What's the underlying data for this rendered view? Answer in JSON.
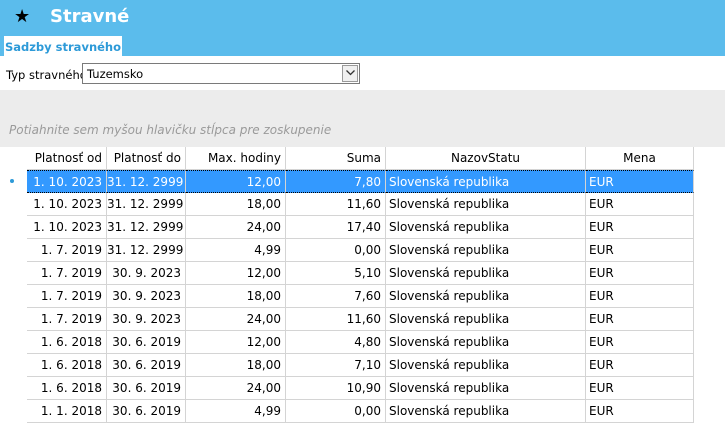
{
  "app": {
    "title": "Stravné",
    "star_icon": "star-icon"
  },
  "tabs": [
    {
      "label": "Sadzby stravného",
      "active": true
    }
  ],
  "filter": {
    "label": "Typ stravného",
    "value": "Tuzemsko"
  },
  "group_panel": {
    "hint": "Potiahnite sem myšou hlavičku stĺpca pre zoskupenie"
  },
  "grid": {
    "columns": [
      "Platnosť od",
      "Platnosť do",
      "Max. hodiny",
      "Suma",
      "NazovStatu",
      "Mena"
    ],
    "selected_row": 0,
    "rows": [
      [
        "1. 10. 2023",
        "31. 12. 2999",
        "12,00",
        "7,80",
        "Slovenská republika",
        "EUR"
      ],
      [
        "1. 10. 2023",
        "31. 12. 2999",
        "18,00",
        "11,60",
        "Slovenská republika",
        "EUR"
      ],
      [
        "1. 10. 2023",
        "31. 12. 2999",
        "24,00",
        "17,40",
        "Slovenská republika",
        "EUR"
      ],
      [
        "1. 7. 2019",
        "31. 12. 2999",
        "4,99",
        "0,00",
        "Slovenská republika",
        "EUR"
      ],
      [
        "1. 7. 2019",
        "30. 9. 2023",
        "12,00",
        "5,10",
        "Slovenská republika",
        "EUR"
      ],
      [
        "1. 7. 2019",
        "30. 9. 2023",
        "18,00",
        "7,60",
        "Slovenská republika",
        "EUR"
      ],
      [
        "1. 7. 2019",
        "30. 9. 2023",
        "24,00",
        "11,60",
        "Slovenská republika",
        "EUR"
      ],
      [
        "1. 6. 2018",
        "30. 6. 2019",
        "12,00",
        "4,80",
        "Slovenská republika",
        "EUR"
      ],
      [
        "1. 6. 2018",
        "30. 6. 2019",
        "18,00",
        "7,10",
        "Slovenská republika",
        "EUR"
      ],
      [
        "1. 6. 2018",
        "30. 6. 2019",
        "24,00",
        "10,90",
        "Slovenská republika",
        "EUR"
      ],
      [
        "1. 1. 2018",
        "30. 6. 2019",
        "4,99",
        "0,00",
        "Slovenská republika",
        "EUR"
      ]
    ]
  },
  "colors": {
    "accent": "#5bbcec",
    "selection": "#3399ff",
    "tab_text": "#2d9ad8"
  }
}
